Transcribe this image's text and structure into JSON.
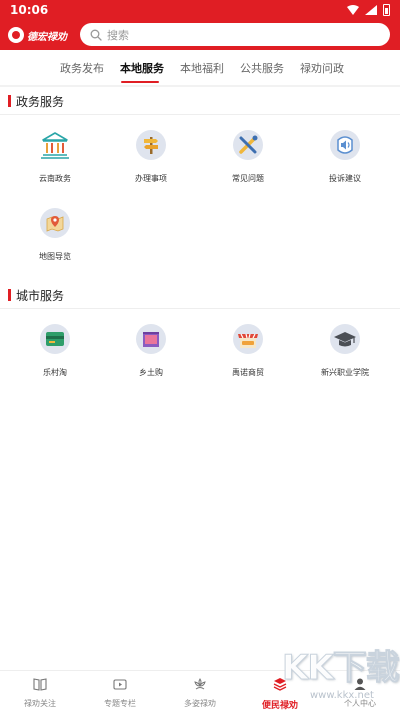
{
  "status_bar": {
    "time": "10:06"
  },
  "header": {
    "logo_text": "德宏禄劝",
    "search_placeholder": "搜索"
  },
  "tabs": [
    {
      "label": "政务发布",
      "active": false
    },
    {
      "label": "本地服务",
      "active": true
    },
    {
      "label": "本地福利",
      "active": false
    },
    {
      "label": "公共服务",
      "active": false
    },
    {
      "label": "禄劝问政",
      "active": false
    }
  ],
  "sections": [
    {
      "title": "政务服务",
      "items": [
        {
          "label": "云南政务",
          "icon": "government-building-icon"
        },
        {
          "label": "办理事项",
          "icon": "signpost-icon"
        },
        {
          "label": "常见问题",
          "icon": "tools-icon"
        },
        {
          "label": "投诉建议",
          "icon": "speaker-icon"
        },
        {
          "label": "地图导览",
          "icon": "map-pin-icon"
        }
      ]
    },
    {
      "title": "城市服务",
      "items": [
        {
          "label": "乐村淘",
          "icon": "shop-card-icon"
        },
        {
          "label": "乡土购",
          "icon": "gift-box-icon"
        },
        {
          "label": "禹诺商贸",
          "icon": "storefront-icon"
        },
        {
          "label": "新兴职业学院",
          "icon": "graduation-cap-icon"
        }
      ]
    }
  ],
  "bottom_nav": [
    {
      "label": "禄劝关注",
      "icon": "book-icon",
      "active": false
    },
    {
      "label": "专题专栏",
      "icon": "video-icon",
      "active": false
    },
    {
      "label": "多姿禄劝",
      "icon": "flower-icon",
      "active": false
    },
    {
      "label": "便民禄劝",
      "icon": "layers-icon",
      "active": true
    },
    {
      "label": "个人中心",
      "icon": "person-icon",
      "active": false
    }
  ],
  "watermark": {
    "big": "KK下载",
    "small": "www.kkx.net"
  },
  "colors": {
    "brand_red": "#e01e24",
    "icon_circle": "#dfe4ee"
  }
}
